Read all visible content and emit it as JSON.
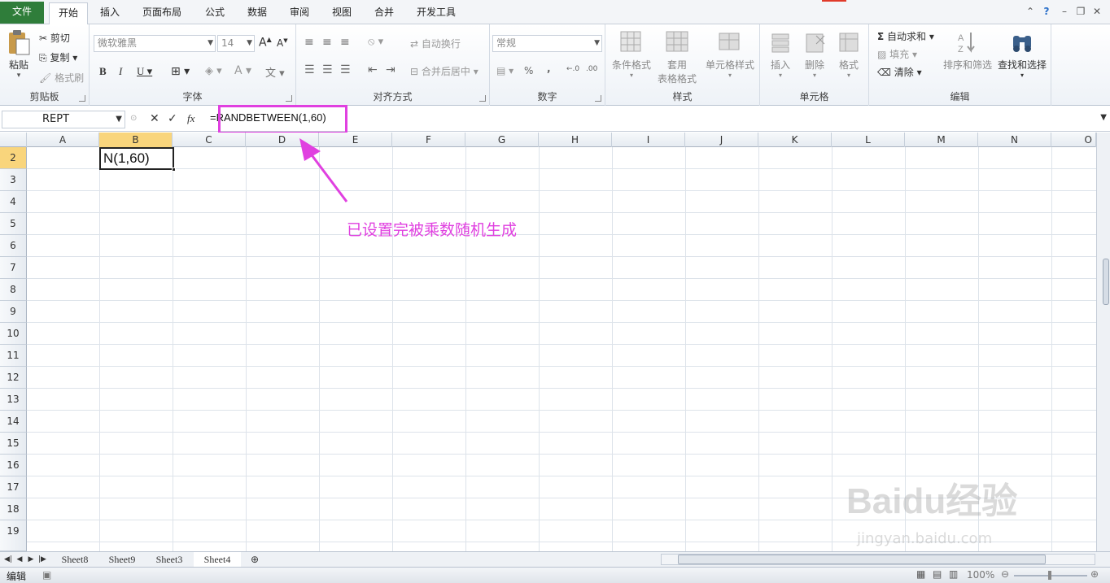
{
  "menu": {
    "tabs": [
      "文件",
      "开始",
      "插入",
      "页面布局",
      "公式",
      "数据",
      "审阅",
      "视图",
      "合并",
      "开发工具"
    ],
    "active": "开始"
  },
  "ribbon": {
    "clipboard": {
      "label": "剪贴板",
      "paste": "粘贴",
      "cut": "剪切",
      "copy": "复制",
      "format_painter": "格式刷"
    },
    "font": {
      "label": "字体",
      "font_name": "微软雅黑",
      "font_size": "14"
    },
    "alignment": {
      "label": "对齐方式",
      "wrap": "自动换行",
      "merge": "合并后居中"
    },
    "number": {
      "label": "数字",
      "format": "常规",
      "percent": "%",
      "comma": ","
    },
    "styles": {
      "label": "样式",
      "cond": "条件格式",
      "table1": "套用",
      "table2": "表格格式",
      "cell_styles": "单元格样式"
    },
    "cells": {
      "label": "单元格",
      "insert": "插入",
      "delete": "删除",
      "format": "格式"
    },
    "editing": {
      "label": "编辑",
      "autosum": "自动求和",
      "fill": "填充",
      "clear": "清除",
      "sort": "排序和筛选",
      "find": "查找和选择"
    }
  },
  "formula_bar": {
    "name_box": "REPT",
    "fx": "fx",
    "formula": "=RANDBETWEEN(1,60)"
  },
  "grid": {
    "columns": [
      "A",
      "B",
      "C",
      "D",
      "E",
      "F",
      "G",
      "H",
      "I",
      "J",
      "K",
      "L",
      "M",
      "N",
      "O"
    ],
    "rows": [
      "2",
      "3",
      "4",
      "5",
      "6",
      "7",
      "8",
      "9",
      "10",
      "11",
      "12",
      "13",
      "14",
      "15",
      "16",
      "17",
      "18",
      "19"
    ],
    "active_cell_value": "N(1,60)"
  },
  "annotation": "已设置完被乘数随机生成",
  "sheets": [
    "Sheet8",
    "Sheet9",
    "Sheet3",
    "Sheet4"
  ],
  "active_sheet": "Sheet4",
  "status": {
    "mode": "编辑",
    "zoom": "100%"
  },
  "watermark": {
    "brand": "Baidu经验",
    "url": "jingyan.baidu.com"
  },
  "colors": {
    "accent": "#e040e0",
    "file_tab": "#2f7d3a",
    "selected_header": "#f9d57c"
  }
}
